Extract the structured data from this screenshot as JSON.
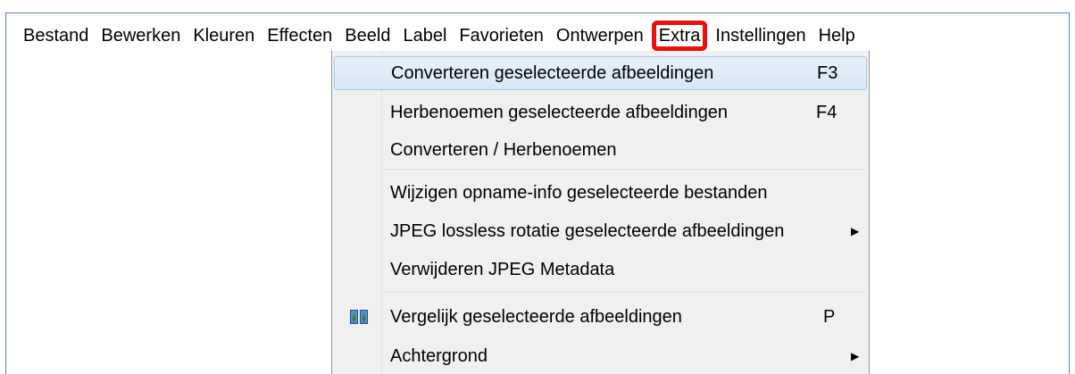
{
  "menubar": {
    "items": [
      {
        "label": "Bestand"
      },
      {
        "label": "Bewerken"
      },
      {
        "label": "Kleuren"
      },
      {
        "label": "Effecten"
      },
      {
        "label": "Beeld"
      },
      {
        "label": "Label"
      },
      {
        "label": "Favorieten"
      },
      {
        "label": "Ontwerpen"
      },
      {
        "label": "Extra",
        "open": true
      },
      {
        "label": "Instellingen"
      },
      {
        "label": "Help"
      }
    ]
  },
  "dropdown": {
    "items": [
      {
        "label": "Converteren geselecteerde afbeeldingen",
        "shortcut": "F3",
        "highlighted": true
      },
      {
        "label": "Herbenoemen geselecteerde afbeeldingen",
        "shortcut": "F4"
      },
      {
        "label": "Converteren / Herbenoemen"
      },
      {
        "label": "Wijzigen opname-info geselecteerde bestanden"
      },
      {
        "label": "JPEG lossless rotatie geselecteerde afbeeldingen",
        "submenu": true
      },
      {
        "label": "Verwijderen JPEG Metadata"
      },
      {
        "label": "Vergelijk geselecteerde afbeeldingen",
        "shortcut": "P",
        "icon": "compare-images-icon"
      },
      {
        "label": "Achtergrond",
        "submenu": true
      }
    ]
  },
  "colors": {
    "highlight_border": "#e8110f",
    "hover_bg": "#dce9f7",
    "menu_bg": "#f0f0f0"
  }
}
